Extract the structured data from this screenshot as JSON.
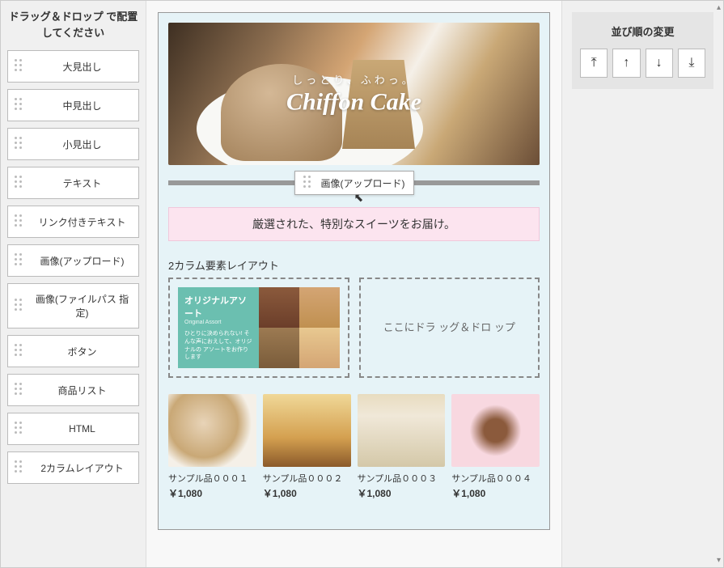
{
  "leftPanel": {
    "title": "ドラッグ＆ドロップ\nで配置してください",
    "blocks": [
      {
        "label": "大見出し"
      },
      {
        "label": "中見出し"
      },
      {
        "label": "小見出し"
      },
      {
        "label": "テキスト"
      },
      {
        "label": "リンク付きテキスト"
      },
      {
        "label": "画像(アップロード)"
      },
      {
        "label": "画像(ファイルパス\n指定)"
      },
      {
        "label": "ボタン"
      },
      {
        "label": "商品リスト"
      },
      {
        "label": "HTML"
      },
      {
        "label": "2カラムレイアウト"
      }
    ]
  },
  "canvas": {
    "hero": {
      "sub": "しっとり、ふわっ。",
      "main": "Chiffon Cake"
    },
    "draggingChip": "画像(アップロード)",
    "tagline": "厳選された、特別なスイーツをお届け。",
    "twoCol": {
      "title": "2カラム要素レイアウト",
      "assort": {
        "titleJp": "オリジナルアソート",
        "titleEn": "Original Assort",
        "desc": "ひとりに決められない!\nそんな声におえして、オリジナルの\nアソートをお作りします"
      },
      "dropHint": "ここにドラ\nッグ＆ドロ\nップ"
    },
    "products": [
      {
        "name": "サンプル品０００１",
        "price": "￥1,080"
      },
      {
        "name": "サンプル品０００２",
        "price": "￥1,080"
      },
      {
        "name": "サンプル品０００３",
        "price": "￥1,080"
      },
      {
        "name": "サンプル品０００４",
        "price": "￥1,080"
      }
    ]
  },
  "rightPanel": {
    "title": "並び順の変更",
    "buttons": [
      "⤒",
      "↑",
      "↓",
      "⤓"
    ]
  }
}
